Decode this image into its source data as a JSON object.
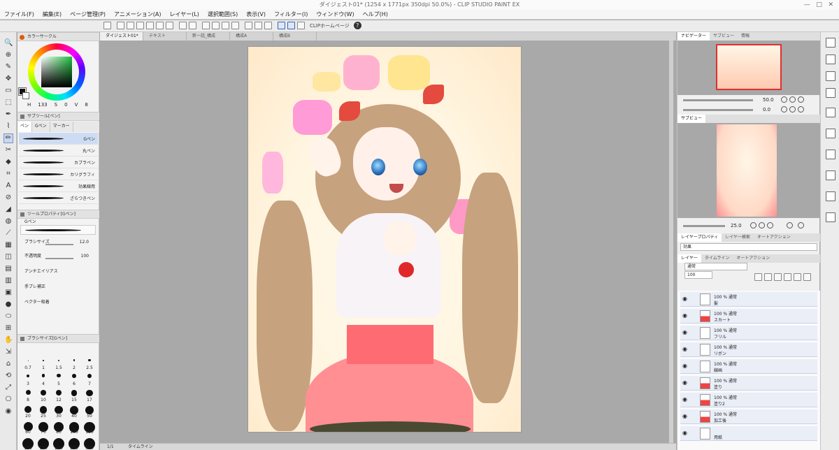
{
  "window": {
    "title": "ダイジェスト01* (1254 x 1771px 350dpi 50.0%) - CLIP STUDIO PAINT EX",
    "controls": [
      "—",
      "□",
      "✕"
    ]
  },
  "menu": [
    "ファイル(F)",
    "編集(E)",
    "ページ管理(P)",
    "アニメーション(A)",
    "レイヤー(L)",
    "選択範囲(S)",
    "表示(V)",
    "フィルター(I)",
    "ウィンドウ(W)",
    "ヘルプ(H)"
  ],
  "command_bar": {
    "clip_home_label": "CLIPホームページ",
    "help_icon": "?"
  },
  "toolbar": {
    "icons": [
      "🔍",
      "⊕",
      "✎",
      "✥",
      "▭",
      "⬚",
      "✒",
      "⌇",
      "✏",
      "✂",
      "◆",
      "⌗",
      "A",
      "⊘",
      "◢",
      "◍",
      "⟋",
      "▦",
      "◫",
      "▤",
      "▥",
      "▣",
      "●",
      "⬭",
      "⊞",
      "✋",
      "⇲",
      "⌂",
      "⟲",
      "⤢",
      "⎔",
      "◉"
    ],
    "selected_index": 8
  },
  "color_panel": {
    "tab_label": "カラーサークル",
    "values": [
      "H",
      "133",
      "S",
      "0",
      "V",
      "8"
    ]
  },
  "subtool_panel": {
    "header_label": "サブツール[ペン]",
    "tabs": [
      "ペン",
      "Gペン",
      "マーカー"
    ],
    "brushes": [
      {
        "name": "Gペン",
        "selected": true
      },
      {
        "name": "丸ペン",
        "selected": false
      },
      {
        "name": "カブラペン",
        "selected": false
      },
      {
        "name": "カリグラフィ",
        "selected": false
      },
      {
        "name": "効果線用",
        "selected": false
      },
      {
        "name": "ざらつきペン",
        "selected": false
      }
    ]
  },
  "tool_property": {
    "header_label": "ツールプロパティ[Gペン]",
    "brush_name": "Gペン",
    "size_label": "ブラシサイズ",
    "size_value": "12.0",
    "opacity_label": "不透明度",
    "opacity_value": "100",
    "antialias_label": "アンチエイリアス",
    "stabilization_label": "手ブレ補正",
    "vector_label": "ベクター吸着"
  },
  "brush_size_panel": {
    "header_label": "ブラシサイズ[Gペン]",
    "sizes": [
      "0.7",
      "1",
      "1.5",
      "2",
      "2.5",
      "3",
      "4",
      "5",
      "6",
      "7",
      "8",
      "10",
      "12",
      "15",
      "17",
      "20",
      "25",
      "30",
      "40",
      "50",
      "60",
      "70",
      "80",
      "100",
      "120",
      "150",
      "170",
      "200",
      "250",
      "300"
    ]
  },
  "canvas": {
    "tabs": [
      "ダイジェスト01*",
      "テキスト",
      "新一話_構成",
      "構成A",
      "構成B"
    ],
    "active_tab": 0,
    "navigator_label": "タイムライン",
    "page_status": "1/1"
  },
  "navigator": {
    "tabs": [
      "ナビゲーター",
      "サブビュー",
      "情報"
    ],
    "zoom": "50.0",
    "rotate": "0.0"
  },
  "subview": {
    "tab_label": "サブビュー",
    "zoom": "25.0"
  },
  "layer_property": {
    "tabs": [
      "レイヤープロパティ",
      "レイヤー検索",
      "オートアクション"
    ],
    "effect_label": "効果"
  },
  "layer_panel": {
    "tabs": [
      "レイヤー",
      "タイムライン",
      "オートアクション"
    ],
    "blend_mode": "通常",
    "opacity": "100",
    "layers": [
      {
        "opacity_blend": "100 % 通常",
        "name": "髪",
        "thumb": "plain"
      },
      {
        "opacity_blend": "100 % 通常",
        "name": "スカート",
        "thumb": "red"
      },
      {
        "opacity_blend": "100 % 通常",
        "name": "フリル",
        "thumb": "plain"
      },
      {
        "opacity_blend": "100 % 通常",
        "name": "リボン",
        "thumb": "plain"
      },
      {
        "opacity_blend": "100 % 通常",
        "name": "線画",
        "thumb": "plain"
      },
      {
        "opacity_blend": "100 % 通常",
        "name": "塗り",
        "thumb": "red"
      },
      {
        "opacity_blend": "100 % 通常",
        "name": "塗り2",
        "thumb": "red"
      },
      {
        "opacity_blend": "100 % 通常",
        "name": "加工後",
        "thumb": "red"
      },
      {
        "opacity_blend": "",
        "name": "用紙",
        "thumb": "plain"
      }
    ]
  }
}
